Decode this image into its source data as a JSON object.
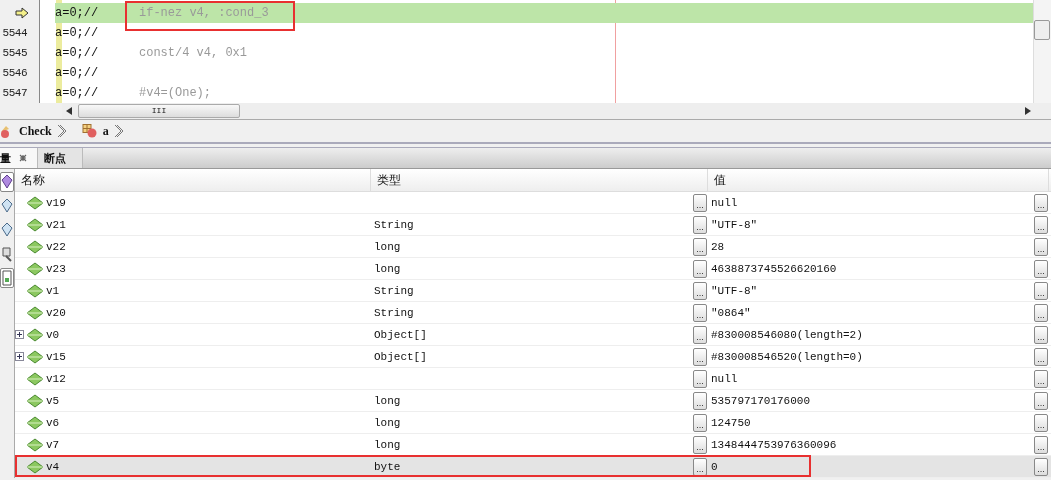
{
  "editor": {
    "lines": [
      {
        "code": "a=0;//",
        "comment": "if-nez v4, :cond_3",
        "current": true,
        "annotated": true
      },
      {
        "number": "5544",
        "code": "a=0;//",
        "current": false,
        "annotated": false
      },
      {
        "number": "5545",
        "code": "a=0;//",
        "comment": "const/4 v4, 0x1",
        "current": false,
        "annotated": false
      },
      {
        "number": "5546",
        "code": "a=0;//",
        "current": false,
        "annotated": false
      },
      {
        "number": "5547",
        "code": "a=0;//",
        "comment": "#v4=(One);",
        "current": false,
        "annotated": false
      }
    ],
    "scroll_thumb_label": "III"
  },
  "breadcrumb": [
    {
      "label": "Check"
    },
    {
      "label": "a"
    }
  ],
  "tabs": [
    {
      "label": "量",
      "selected": true,
      "closable": true
    },
    {
      "label": "断点",
      "selected": false,
      "closable": false
    }
  ],
  "table": {
    "columns": [
      "名称",
      "类型",
      "值"
    ],
    "rows": [
      {
        "name": "v19",
        "value": "null",
        "expandable": false,
        "selected": false,
        "annotated": false,
        "type_button": "...",
        "value_button": "..."
      },
      {
        "name": "v21",
        "type": "String",
        "value": "\"UTF-8\"",
        "expandable": false,
        "selected": false,
        "annotated": false,
        "type_button": "...",
        "value_button": "..."
      },
      {
        "name": "v22",
        "type": "long",
        "value": "28",
        "expandable": false,
        "selected": false,
        "annotated": false,
        "type_button": "...",
        "value_button": "..."
      },
      {
        "name": "v23",
        "type": "long",
        "value": "4638873745526620160",
        "expandable": false,
        "selected": false,
        "annotated": false,
        "type_button": "...",
        "value_button": "..."
      },
      {
        "name": "v1",
        "type": "String",
        "value": "\"UTF-8\"",
        "expandable": false,
        "selected": false,
        "annotated": false,
        "type_button": "...",
        "value_button": "..."
      },
      {
        "name": "v20",
        "type": "String",
        "value": "\"0864\"",
        "expandable": false,
        "selected": false,
        "annotated": false,
        "type_button": "...",
        "value_button": "..."
      },
      {
        "name": "v0",
        "type": "Object[]",
        "value": "#830008546080(length=2)",
        "expandable": true,
        "selected": false,
        "annotated": false,
        "type_button": "...",
        "value_button": "..."
      },
      {
        "name": "v15",
        "type": "Object[]",
        "value": "#830008546520(length=0)",
        "expandable": true,
        "selected": false,
        "annotated": false,
        "type_button": "...",
        "value_button": "..."
      },
      {
        "name": "v12",
        "value": "null",
        "expandable": false,
        "selected": false,
        "annotated": false,
        "type_button": "...",
        "value_button": "..."
      },
      {
        "name": "v5",
        "type": "long",
        "value": "535797170176000",
        "expandable": false,
        "selected": false,
        "annotated": false,
        "type_button": "...",
        "value_button": "..."
      },
      {
        "name": "v6",
        "type": "long",
        "value": "124750",
        "expandable": false,
        "selected": false,
        "annotated": false,
        "type_button": "...",
        "value_button": "..."
      },
      {
        "name": "v7",
        "type": "long",
        "value": "1348444753976360096",
        "expandable": false,
        "selected": false,
        "annotated": false,
        "type_button": "...",
        "value_button": "..."
      },
      {
        "name": "v4",
        "type": "byte",
        "value": "0",
        "expandable": false,
        "selected": true,
        "annotated": true,
        "type_button": "...",
        "value_button": "..."
      }
    ]
  }
}
